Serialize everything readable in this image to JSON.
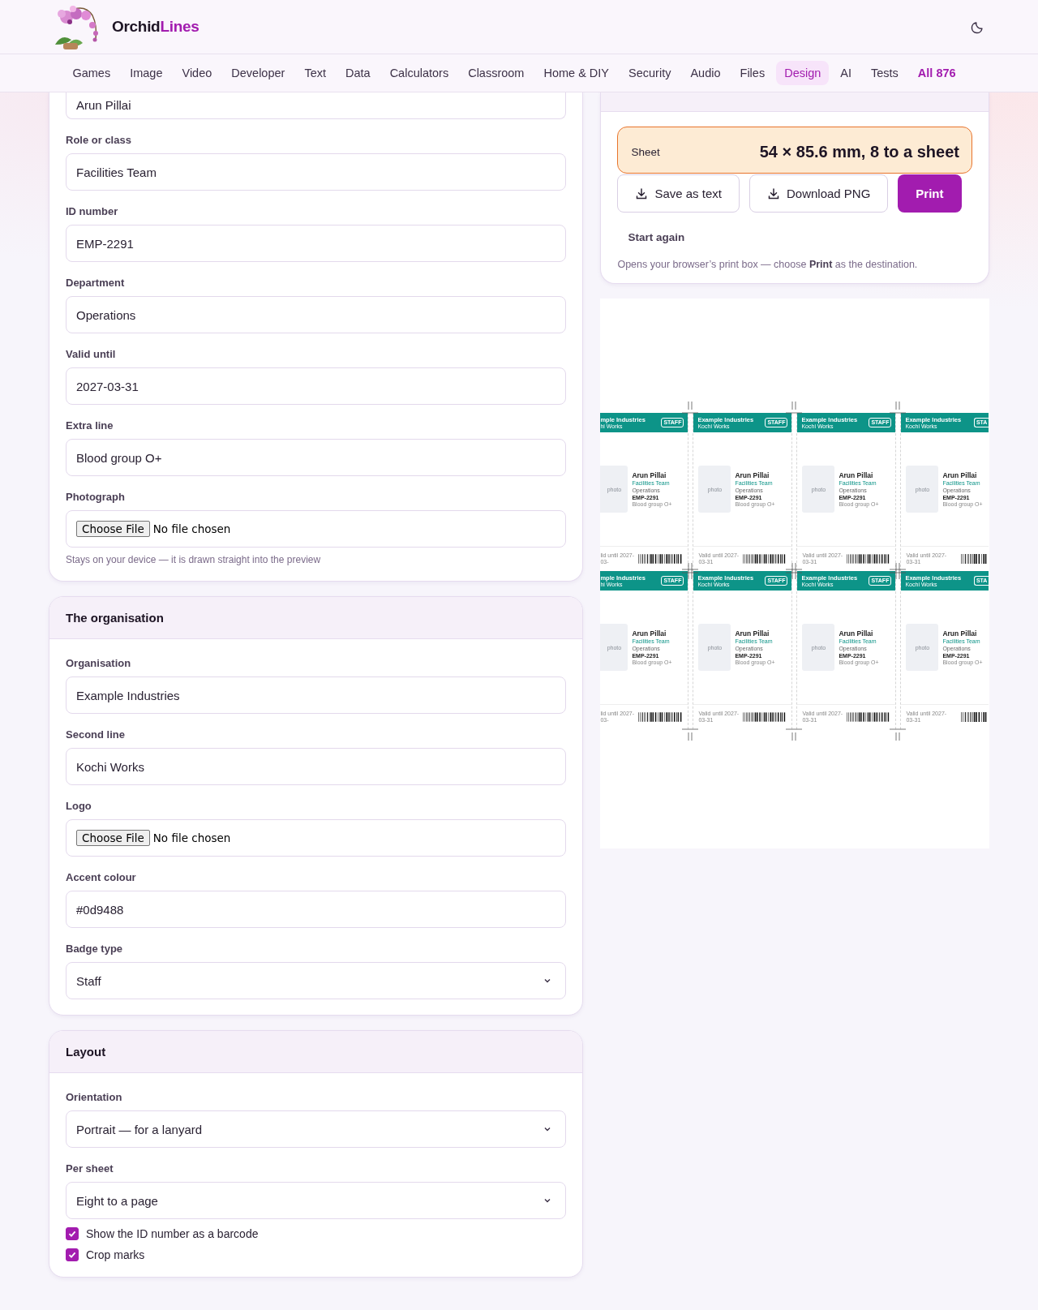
{
  "brand": {
    "name": "Orchid",
    "accent": "Lines"
  },
  "nav": [
    {
      "label": "Games",
      "selected": false,
      "kind": "link"
    },
    {
      "label": "Image",
      "selected": false,
      "kind": "link"
    },
    {
      "label": "Video",
      "selected": false,
      "kind": "link"
    },
    {
      "label": "Developer",
      "selected": false,
      "kind": "link"
    },
    {
      "label": "Text",
      "selected": false,
      "kind": "link"
    },
    {
      "label": "Data",
      "selected": false,
      "kind": "link"
    },
    {
      "label": "Calculators",
      "selected": false,
      "kind": "link"
    },
    {
      "label": "Classroom",
      "selected": false,
      "kind": "link"
    },
    {
      "label": "Home & DIY",
      "selected": false,
      "kind": "link"
    },
    {
      "label": "Security",
      "selected": false,
      "kind": "link"
    },
    {
      "label": "Audio",
      "selected": false,
      "kind": "link"
    },
    {
      "label": "Files",
      "selected": false,
      "kind": "link"
    },
    {
      "label": "Design",
      "selected": true,
      "kind": "link"
    },
    {
      "label": "AI",
      "selected": false,
      "kind": "link"
    },
    {
      "label": "Tests",
      "selected": false,
      "kind": "link"
    },
    {
      "label": "All 876",
      "selected": false,
      "kind": "all"
    }
  ],
  "sections": [
    {
      "fields": [
        {
          "kind": "text",
          "value": "Arun Pillai"
        },
        {
          "kind": "text",
          "label": "Role or class",
          "value": "Facilities Team"
        },
        {
          "kind": "text",
          "label": "ID number",
          "value": "EMP-2291"
        },
        {
          "kind": "text",
          "label": "Department",
          "value": "Operations"
        },
        {
          "kind": "text",
          "label": "Valid until",
          "value": "2027-03-31"
        },
        {
          "kind": "text",
          "label": "Extra line",
          "value": "Blood group O+"
        },
        {
          "kind": "file",
          "label": "Photograph",
          "button": "Choose File",
          "value": "No file chosen",
          "hint": "Stays on your device — it is drawn straight into the preview"
        }
      ]
    },
    {
      "title": "The organisation",
      "fields": [
        {
          "kind": "text",
          "label": "Organisation",
          "value": "Example Industries"
        },
        {
          "kind": "text",
          "label": "Second line",
          "value": "Kochi Works"
        },
        {
          "kind": "file",
          "label": "Logo",
          "button": "Choose File",
          "value": "No file chosen"
        },
        {
          "kind": "text",
          "label": "Accent colour",
          "value": "#0d9488"
        },
        {
          "kind": "select",
          "label": "Badge type",
          "value": "Staff"
        }
      ]
    },
    {
      "title": "Layout",
      "fields": [
        {
          "kind": "select",
          "label": "Orientation",
          "value": "Portrait — for a lanyard"
        },
        {
          "kind": "select",
          "label": "Per sheet",
          "value": "Eight to a page"
        },
        {
          "kind": "checkbox",
          "label": "Show the ID number as a barcode",
          "checked": true
        },
        {
          "kind": "checkbox",
          "label": "Crop marks",
          "checked": true
        }
      ]
    }
  ],
  "preview": {
    "summary_label": "Sheet",
    "summary_value": "54 × 85.6 mm, 8 to a sheet",
    "buttons": [
      {
        "label": "Save as text",
        "kind": "download"
      },
      {
        "label": "Download PNG",
        "kind": "download"
      },
      {
        "label": "Print",
        "kind": "primary"
      }
    ],
    "reset": "Start again",
    "note": "Opens your browser’s print box — choose **Print** as the destination."
  },
  "sheet": {
    "badges": [
      {
        "kind": "cut-left",
        "org": "mple Industries",
        "org_line": "hi Works",
        "type": "STAFF",
        "photo": "photo",
        "name": "Arun Pillai",
        "role": "Facilities Team",
        "department": "Operations",
        "id": "EMP-2291",
        "extra": "Blood group O+",
        "valid": "lid until 2027-03-"
      },
      {
        "kind": "whole",
        "org": "Example Industries",
        "org_line": "Kochi Works",
        "type": "STAFF",
        "photo": "photo",
        "name": "Arun Pillai",
        "role": "Facilities Team",
        "department": "Operations",
        "id": "EMP-2291",
        "extra": "Blood group O+",
        "valid": "Valid until 2027-03-31"
      },
      {
        "kind": "whole",
        "org": "Example Industries",
        "org_line": "Kochi Works",
        "type": "STAFF",
        "photo": "photo",
        "name": "Arun Pillai",
        "role": "Facilities Team",
        "department": "Operations",
        "id": "EMP-2291",
        "extra": "Blood group O+",
        "valid": "Valid until 2027-03-31"
      },
      {
        "kind": "cut-right",
        "org": "Example Industries",
        "org_line": "Kochi Works",
        "type": "STA",
        "photo": "photo",
        "name": "Arun Pillai",
        "role": "Facilities Team",
        "department": "Operations",
        "id": "EMP-2291",
        "extra": "Blood group O+",
        "valid": "Valid until 2027-03-31"
      },
      {
        "kind": "cut-left",
        "org": "mple Industries",
        "org_line": "hi Works",
        "type": "STAFF",
        "photo": "photo",
        "name": "Arun Pillai",
        "role": "Facilities Team",
        "department": "Operations",
        "id": "EMP-2291",
        "extra": "Blood group O+",
        "valid": "lid until 2027-03-"
      },
      {
        "kind": "whole",
        "org": "Example Industries",
        "org_line": "Kochi Works",
        "type": "STAFF",
        "photo": "photo",
        "name": "Arun Pillai",
        "role": "Facilities Team",
        "department": "Operations",
        "id": "EMP-2291",
        "extra": "Blood group O+",
        "valid": "Valid until 2027-03-31"
      },
      {
        "kind": "whole",
        "org": "Example Industries",
        "org_line": "Kochi Works",
        "type": "STAFF",
        "photo": "photo",
        "name": "Arun Pillai",
        "role": "Facilities Team",
        "department": "Operations",
        "id": "EMP-2291",
        "extra": "Blood group O+",
        "valid": "Valid until 2027-03-31"
      },
      {
        "kind": "cut-right",
        "org": "Example Industries",
        "org_line": "Kochi Works",
        "type": "STA",
        "photo": "photo",
        "name": "Arun Pillai",
        "role": "Facilities Team",
        "department": "Operations",
        "id": "EMP-2291",
        "extra": "Blood group O+",
        "valid": "Valid until 2027-03-31"
      }
    ]
  }
}
